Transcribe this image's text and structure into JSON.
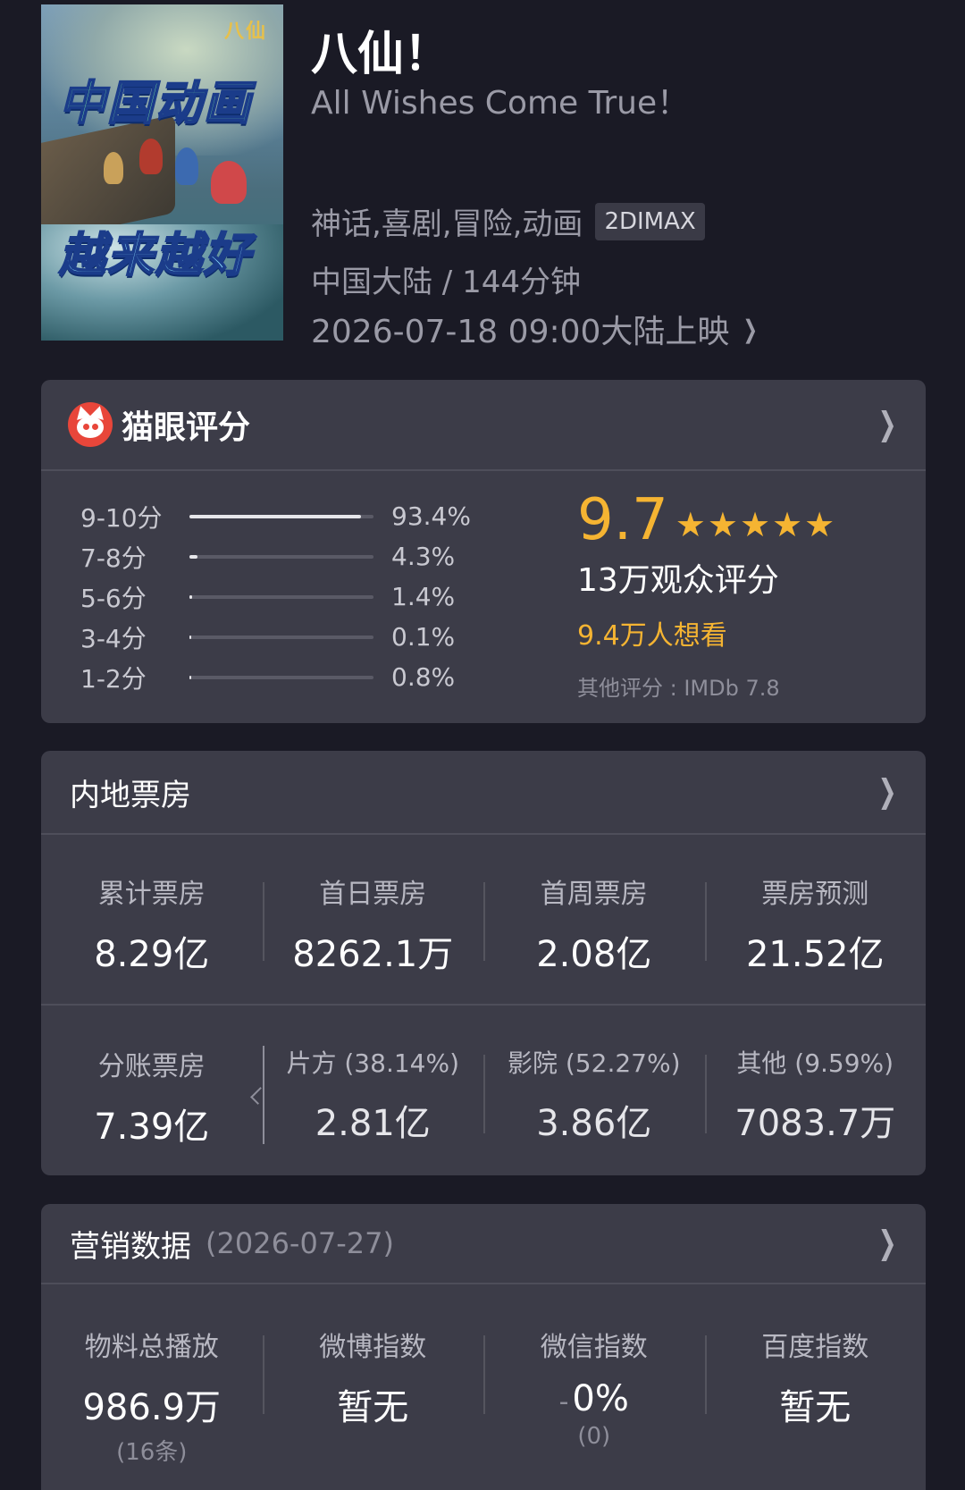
{
  "movie": {
    "title": "八仙！",
    "subtitle": "All Wishes Come True！",
    "genres": "神话,喜剧,冒险,动画",
    "format_badge": "2DIMAX",
    "region_duration": "中国大陆 / 144分钟",
    "release": "2026-07-18 09:00大陆上映",
    "poster": {
      "logo_text": "八仙",
      "headline_top": "中国动画",
      "headline_bottom": "越来越好"
    }
  },
  "rating": {
    "brand": "猫眼评分",
    "distribution": [
      {
        "label": "9-10分",
        "percent_text": "93.4%",
        "percent": 93.4
      },
      {
        "label": "7-8分",
        "percent_text": "4.3%",
        "percent": 4.3
      },
      {
        "label": "5-6分",
        "percent_text": "1.4%",
        "percent": 1.4
      },
      {
        "label": "3-4分",
        "percent_text": "0.1%",
        "percent": 0.1
      },
      {
        "label": "1-2分",
        "percent_text": "0.8%",
        "percent": 0.8
      }
    ],
    "score": "9.7",
    "stars": 5,
    "raters": "13万观众评分",
    "wish": "9.4万人想看",
    "other": "其他评分 : IMDb 7.8",
    "accent_color": "#f5b432",
    "brand_color": "#e8463a"
  },
  "box_office": {
    "title": "内地票房",
    "row1": [
      {
        "label": "累计票房",
        "value": "8.29亿"
      },
      {
        "label": "首日票房",
        "value": "8262.1万"
      },
      {
        "label": "首周票房",
        "value": "2.08亿"
      },
      {
        "label": "票房预测",
        "value": "21.52亿"
      }
    ],
    "row2": [
      {
        "label": "分账票房",
        "value": "7.39亿"
      },
      {
        "label": "片方 (38.14%)",
        "value": "2.81亿"
      },
      {
        "label": "影院 (52.27%)",
        "value": "3.86亿"
      },
      {
        "label": "其他 (9.59%)",
        "value": "7083.7万"
      }
    ]
  },
  "marketing": {
    "title": "营销数据",
    "date": "(2026-07-27)",
    "stats": [
      {
        "label": "物料总播放",
        "value": "986.9万",
        "sub": "(16条)"
      },
      {
        "label": "微博指数",
        "value": "暂无",
        "sub": ""
      },
      {
        "label": "微信指数",
        "value": "0%",
        "prefix": "-",
        "sub": "(0)"
      },
      {
        "label": "百度指数",
        "value": "暂无",
        "sub": ""
      }
    ]
  },
  "icons": {
    "chevron": "chevron-right-icon",
    "star": "star-icon",
    "logo": "maoyan-cat-icon"
  }
}
